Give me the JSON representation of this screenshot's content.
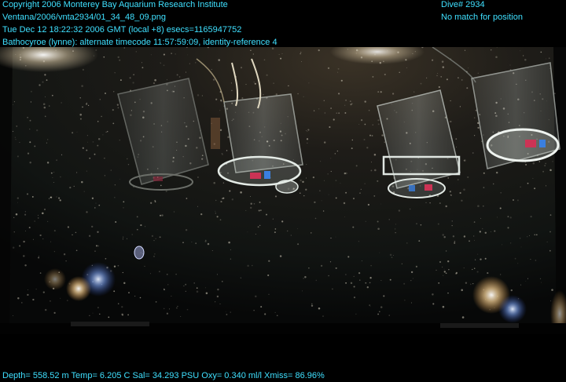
{
  "header": {
    "copyright": "Copyright 2006 Monterey Bay Aquarium Research Institute",
    "file_path": "Ventana/2006/vnta2934/01_34_48_09.png",
    "datetime": "Tue Dec 12 18:22:32 2006 GMT (local +8)  esecs=1165947752",
    "annotation": "Bathocyroe (lynne): alternate timecode 11:57:59:09, identity-reference 4",
    "dive": "Dive# 2934",
    "position": "No match for position"
  },
  "footer": {
    "telemetry": "Depth= 558.52 m  Temp= 6.205 C  Sal= 34.293 PSU  Oxy= 0.340 ml/l  Xmiss= 86.96%"
  },
  "colors": {
    "overlay_text": "#3fe0ff",
    "background": "#000000"
  }
}
